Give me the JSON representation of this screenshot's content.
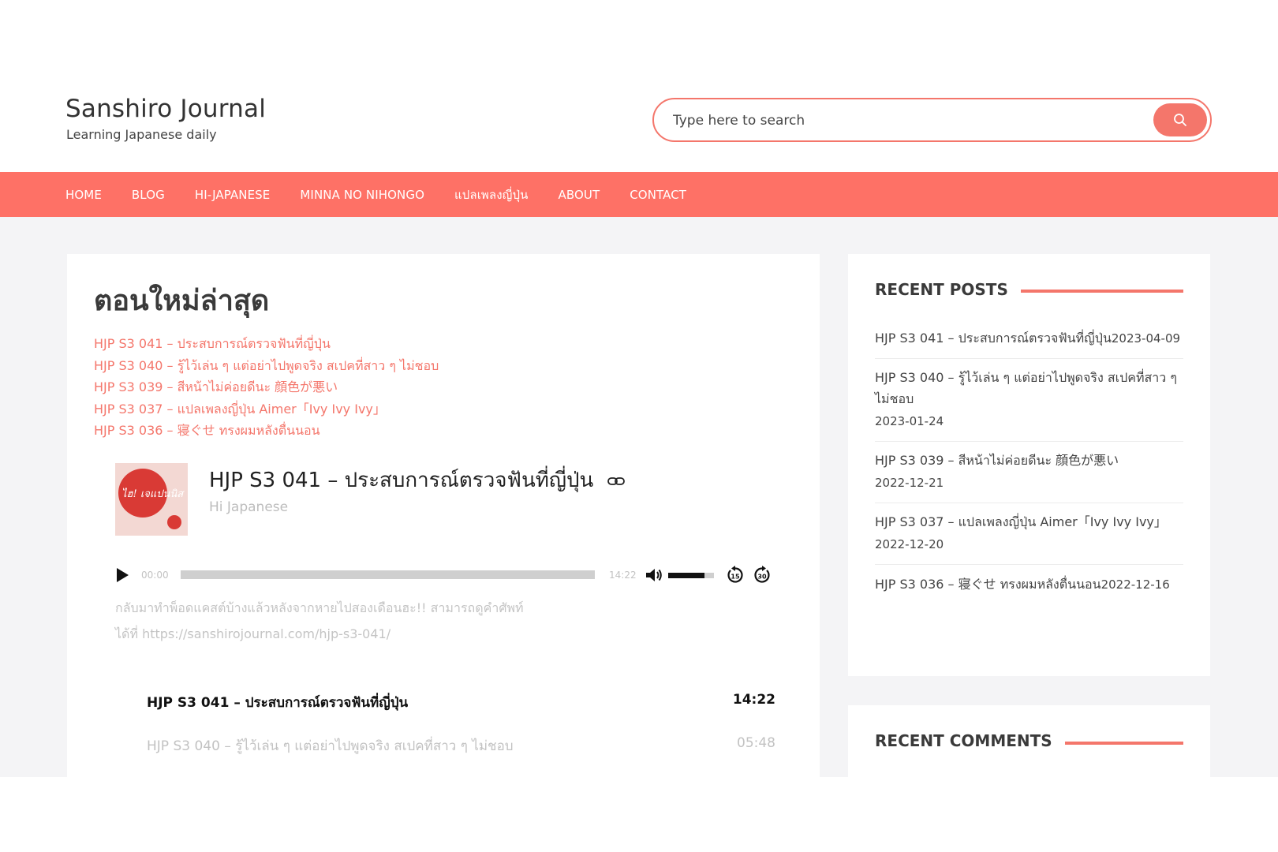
{
  "header": {
    "site_title": "Sanshiro Journal",
    "tagline": "Learning Japanese daily",
    "search_placeholder": "Type here to search"
  },
  "nav": {
    "items": [
      "HOME",
      "BLOG",
      "HI-JAPANESE",
      "MINNA NO NIHONGO",
      "แปลเพลงญี่ปุ่น",
      "ABOUT",
      "CONTACT"
    ]
  },
  "main": {
    "section_title": "ตอนใหม่ล่าสุด",
    "latest_links": [
      "HJP S3 041 – ประสบการณ์ตรวจฟันที่ญี่ปุ่น",
      "HJP S3 040 – รู้ไว้เล่น ๆ แต่อย่าไปพูดจริง สเปคที่สาว ๆ ไม่ชอบ",
      "HJP S3 039 – สีหน้าไม่ค่อยดีนะ 顔色が悪い",
      "HJP S3 037 – แปลเพลงญี่ปุ่น Aimer「Ivy Ivy Ivy」",
      "HJP S3 036 – 寝ぐせ ทรงผมหลังตื่นนอน"
    ],
    "episode": {
      "title": "HJP S3 041 – ประสบการณ์ตรวจฟันที่ญี่ปุ่น",
      "show": "Hi Japanese",
      "art_text": "ไฮ! เจแปนนิส",
      "icons": {
        "link": "link-icon",
        "play": "play-icon",
        "volume": "volume-icon",
        "skip_back": "skip-back-15-icon",
        "skip_fwd": "skip-forward-30-icon"
      },
      "time_current": "00:00",
      "time_duration": "14:22",
      "progress_fraction": 0,
      "volume_fraction": 0.8,
      "skip_back_label": "15",
      "skip_fwd_label": "30",
      "description_line1": "กลับมาทำพ็อดแคสต์บ้างแล้วหลังจากหายไปสองเดือนฮะ!!   สามารถดูคำศัพท์",
      "description_line2": "ได้ที่ https://sanshirojournal.com/hjp-s3-041/"
    },
    "playlist": [
      {
        "title": "HJP S3 041 – ประสบการณ์ตรวจฟันที่ญี่ปุ่น",
        "duration": "14:22",
        "active": true
      },
      {
        "title": "HJP S3 040 – รู้ไว้เล่น ๆ แต่อย่าไปพูดจริง สเปคที่สาว ๆ ไม่ชอบ",
        "duration": "05:48",
        "active": false
      }
    ]
  },
  "sidebar": {
    "recent_posts_title": "RECENT POSTS",
    "recent_posts": [
      {
        "title": "HJP S3 041 – ประสบการณ์ตรวจฟันที่ญี่ปุ่น",
        "date": "2023-04-09",
        "inline_date": true
      },
      {
        "title": "HJP S3 040 – รู้ไว้เล่น ๆ แต่อย่าไปพูดจริง สเปคที่สาว ๆ ไม่ชอบ",
        "date": "2023-01-24",
        "inline_date": false
      },
      {
        "title": "HJP S3 039 – สีหน้าไม่ค่อยดีนะ 顔色が悪い",
        "date": "2022-12-21",
        "inline_date": false
      },
      {
        "title": "HJP S3 037 – แปลเพลงญี่ปุ่น Aimer「Ivy Ivy Ivy」",
        "date": "2022-12-20",
        "inline_date": false
      },
      {
        "title": "HJP S3 036 – 寝ぐせ ทรงผมหลังตื่นนอน",
        "date": "2022-12-16",
        "inline_date": true
      }
    ],
    "recent_comments_title": "RECENT COMMENTS"
  },
  "colors": {
    "accent": "#fe7166",
    "link": "#f4766b",
    "background": "#f4f4f6"
  }
}
